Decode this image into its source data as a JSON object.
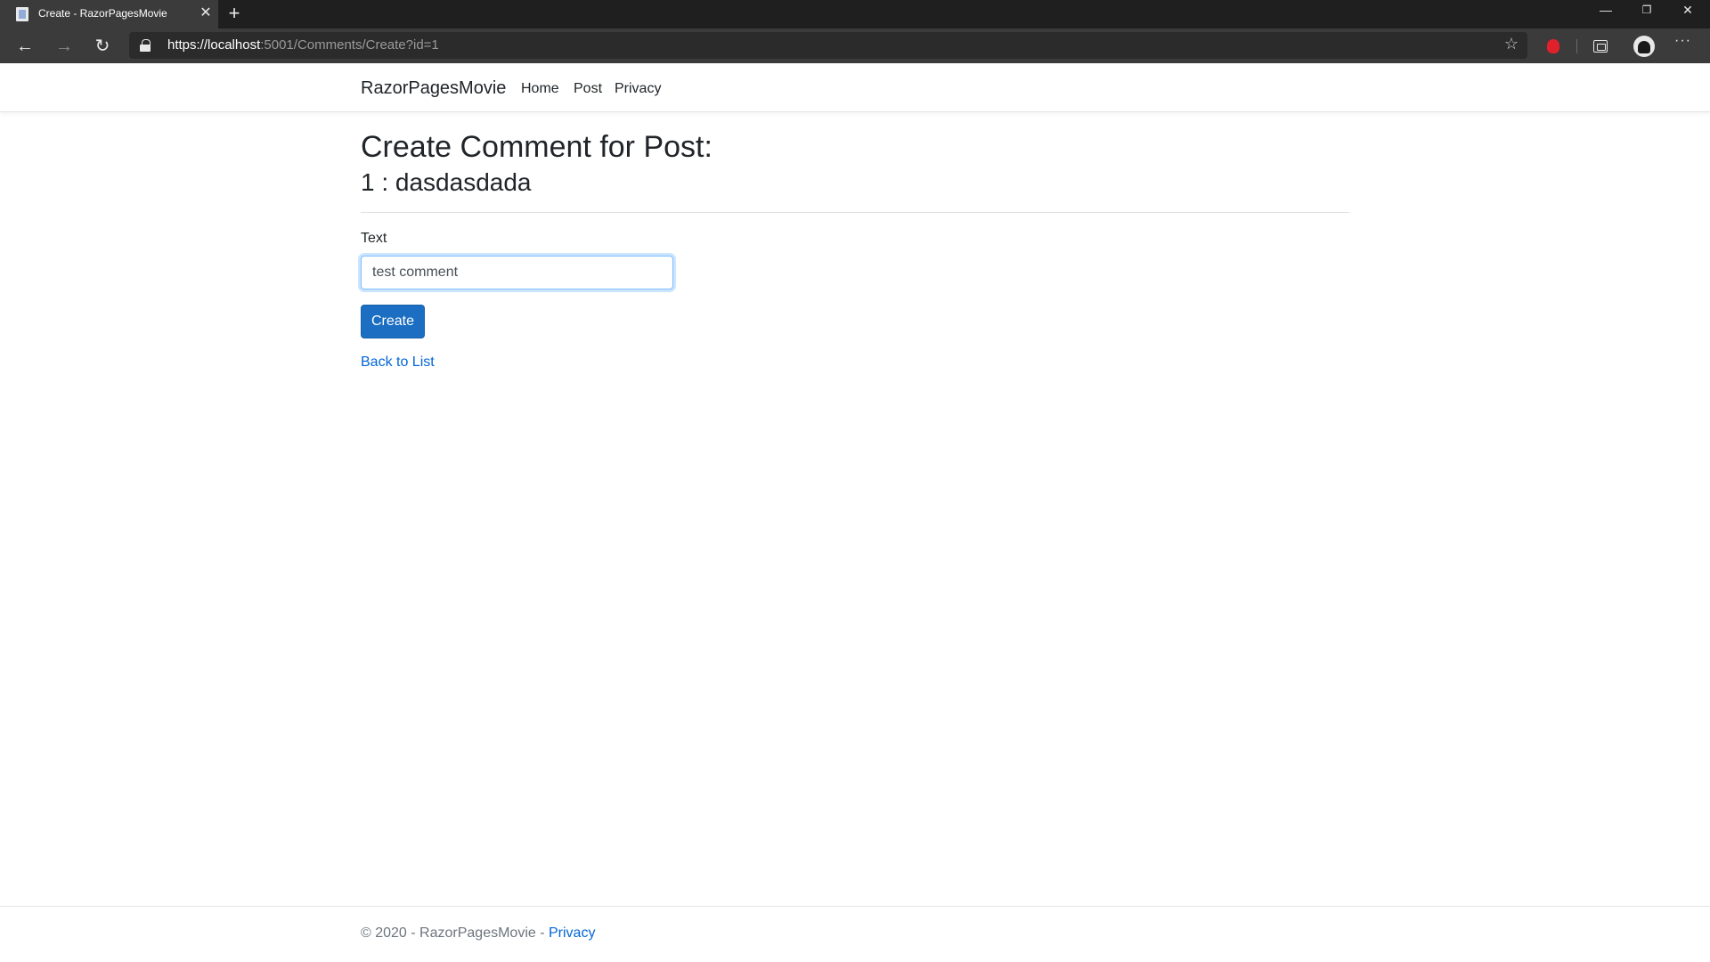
{
  "browser": {
    "tab_title": "Create - RazorPagesMovie",
    "tab_close": "✕",
    "new_tab": "+",
    "url_scheme": "https://",
    "url_host": "localhost",
    "url_rest": ":5001/Comments/Create?id=1",
    "window_controls": {
      "minimize": "—",
      "restore": "❐",
      "close": "✕"
    },
    "menu": "···"
  },
  "navbar": {
    "brand": "RazorPagesMovie",
    "links": [
      "Home",
      "Post",
      "Privacy"
    ]
  },
  "page": {
    "title": "Create Comment for Post:",
    "subtitle": "1 : dasdasdada",
    "field_label": "Text",
    "field_value": "test comment",
    "submit_label": "Create",
    "back_link": "Back to List"
  },
  "footer": {
    "text": "© 2020 - RazorPagesMovie - ",
    "link": "Privacy"
  },
  "colors": {
    "primary_button": "#1b6ec2",
    "link": "#0366d6",
    "chrome_bg": "#3b3b3b"
  }
}
